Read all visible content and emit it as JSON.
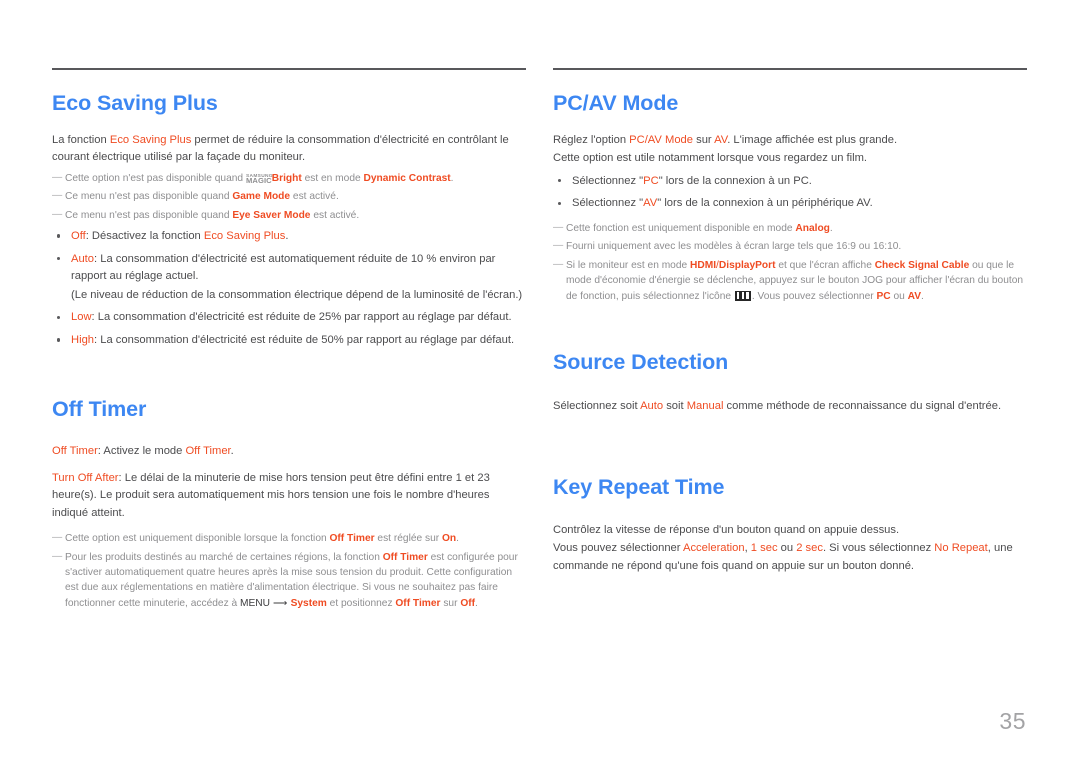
{
  "document": {
    "page_number": "35",
    "colors": {
      "heading_blue": "#3d87f2",
      "accent_orange": "#ef4c23",
      "body_gray": "#4c4c4e",
      "note_gray": "#8e8e90",
      "rule_gray": "#58585b"
    }
  },
  "left_column": {
    "eco_saving_plus": {
      "title": "Eco Saving Plus",
      "intro": {
        "part1": "La fonction ",
        "term": "Eco Saving Plus",
        "part2": " permet de réduire la consommation d'électricité en contrôlant le courant électrique utilisé par la façade du moniteur."
      },
      "notes": [
        {
          "dash": "―",
          "part1": "Cette option n'est pas disponible quand ",
          "logo_top": "SAMSUNG",
          "logo_bottom": "MAGIC",
          "term1": "Bright",
          "part2": " est en mode ",
          "term2": "Dynamic Contrast",
          "part3": "."
        },
        {
          "dash": "―",
          "part1": "Ce menu n'est pas disponible quand ",
          "term1": "Game Mode",
          "part2": " est activé."
        },
        {
          "dash": "―",
          "part1": "Ce menu n'est pas disponible quand ",
          "term1": "Eye Saver Mode",
          "part2": " est activé."
        }
      ],
      "bullets": [
        {
          "term": "Off",
          "part1": ": Désactivez la fonction ",
          "term2": "Eco Saving Plus",
          "part2": "."
        },
        {
          "term": "Auto",
          "part1": ": La consommation d'électricité est automatiquement réduite de 10 % environ par rapport au réglage actuel.",
          "sub": "(Le niveau de réduction de la consommation électrique dépend de la luminosité de l'écran.)"
        },
        {
          "term": "Low",
          "part1": ": La consommation d'électricité est réduite de 25% par rapport au réglage par défaut."
        },
        {
          "term": "High",
          "part1": ": La consommation d'électricité est réduite de 50% par rapport au réglage par défaut."
        }
      ]
    },
    "off_timer": {
      "title": "Off Timer",
      "paras": [
        {
          "term1": "Off Timer",
          "part1": ": Activez le mode ",
          "term2": "Off Timer",
          "part2": "."
        },
        {
          "term1": "Turn Off After",
          "part1": ": Le délai de la minuterie de mise hors tension peut être défini entre 1 et 23 heure(s). Le produit sera automatiquement mis hors tension une fois le nombre d'heures indiqué atteint."
        }
      ],
      "notes": [
        {
          "dash": "―",
          "part1": "Cette option est uniquement disponible lorsque la fonction ",
          "term1": "Off Timer",
          "part2": " est réglée sur ",
          "term2": "On",
          "part3": "."
        },
        {
          "dash": "―",
          "part1": "Pour les produits destinés au marché de certaines régions, la fonction ",
          "term1": "Off Timer",
          "part2": " est configurée pour s'activer automatiquement quatre heures après la mise sous tension du produit. Cette configuration est due aux réglementations en matière d'alimentation électrique. Si vous ne souhaitez pas faire fonctionner cette minuterie, accédez à ",
          "menu_word": "MENU",
          "arrow": "⟶",
          "term2": "System",
          "part3": " et positionnez ",
          "term3": "Off Timer",
          "part4": " sur ",
          "term4": "Off",
          "part5": "."
        }
      ]
    }
  },
  "right_column": {
    "pc_av_mode": {
      "title": "PC/AV Mode",
      "paras": [
        {
          "part1": "Réglez l'option ",
          "term1": "PC/AV Mode",
          "part2": " sur ",
          "term2": "AV",
          "part3": ". L'image affichée est plus grande."
        },
        {
          "part1": "Cette option est utile notamment lorsque vous regardez un film."
        }
      ],
      "bullets": [
        {
          "part1": "Sélectionnez \"",
          "term": "PC",
          "part2": "\" lors de la connexion à un PC."
        },
        {
          "part1": "Sélectionnez \"",
          "term": "AV",
          "part2": "\" lors de la connexion à un périphérique AV."
        }
      ],
      "notes": [
        {
          "dash": "―",
          "part1": "Cette fonction est uniquement disponible en mode ",
          "term1": "Analog",
          "part2": "."
        },
        {
          "dash": "―",
          "part1": "Fourni uniquement avec les modèles à écran large tels que 16:9 ou 16:10."
        },
        {
          "dash": "―",
          "part1": "Si le moniteur est en mode ",
          "term1": "HDMI",
          "slash": "/",
          "term2": "DisplayPort",
          "part2": " et que l'écran affiche ",
          "term3": "Check Signal Cable",
          "part3": " ou que le mode d'économie d'énergie se déclenche, appuyez sur le bouton JOG pour afficher l'écran du bouton de fonction, puis sélectionnez l'icône ",
          "icon": "source-input-icon",
          "part4": ". Vous pouvez sélectionner ",
          "term4": "PC",
          "part5": " ou ",
          "term5": "AV",
          "part6": "."
        }
      ]
    },
    "source_detection": {
      "title": "Source Detection",
      "para": {
        "part1": "Sélectionnez soit ",
        "term1": "Auto",
        "part2": " soit ",
        "term2": "Manual",
        "part3": " comme méthode de reconnaissance du signal d'entrée."
      }
    },
    "key_repeat_time": {
      "title": "Key Repeat Time",
      "paras": [
        {
          "part1": "Contrôlez la vitesse de réponse d'un bouton quand on appuie dessus."
        },
        {
          "part1": "Vous pouvez sélectionner ",
          "term1": "Acceleration",
          "part2": ", ",
          "term2": "1 sec",
          "part3": " ou ",
          "term3": "2 sec",
          "part4": ". Si vous sélectionnez ",
          "term4": "No Repeat",
          "part5": ", une commande ne répond qu'une fois quand on appuie sur un bouton donné."
        }
      ]
    }
  }
}
